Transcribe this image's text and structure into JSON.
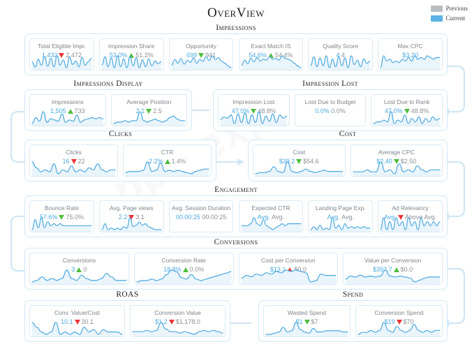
{
  "header": {
    "title": "OverView",
    "legend": [
      {
        "label": "Previous",
        "color": "#b9bdc1",
        "name": "previous"
      },
      {
        "label": "Current",
        "color": "#5cb3e4",
        "name": "current"
      }
    ]
  },
  "colors": {
    "current": "#4aa9e0",
    "previous": "#8a9097",
    "up_good": "#4fbe3f",
    "down_good": "#4fbe3f",
    "bad": "#ed3437",
    "card_border": "#d9eaf6",
    "group_border": "#cfe7f7",
    "spark_line": "#4aa9e0",
    "spark_fill": "#eaf4fb"
  },
  "watermark": "ppc expo",
  "groups": [
    {
      "id": "impressions",
      "title": "Impressions",
      "cards": [
        {
          "name": "total-eligible-impr",
          "label": "Total Eligible Impr.",
          "current": "1,432",
          "previous": "2,472",
          "trend": "down",
          "trend_tone": "bad",
          "spark": [
            10,
            4,
            13,
            6,
            16,
            5,
            14,
            4,
            17,
            6,
            12,
            3,
            16,
            7,
            11,
            4,
            15,
            6,
            10,
            14
          ]
        },
        {
          "name": "impression-share",
          "label": "Impression Share",
          "current": "53.0%",
          "previous": "51.2%",
          "trend": "up",
          "trend_tone": "good",
          "spark": [
            8,
            16,
            6,
            15,
            5,
            17,
            6,
            14,
            5,
            16,
            7,
            15,
            5,
            13,
            6,
            14,
            7,
            12,
            9,
            11
          ]
        },
        {
          "name": "opportunity",
          "label": "Opportunity",
          "current": "699",
          "previous": "941",
          "trend": "down",
          "trend_tone": "good",
          "spark": [
            6,
            12,
            8,
            13,
            7,
            11,
            9,
            14,
            8,
            12,
            10,
            15,
            11,
            16,
            12,
            14,
            10,
            8,
            5,
            3
          ]
        },
        {
          "name": "exact-match-is",
          "label": "Exact Match IS",
          "current": "54.6%",
          "previous": "54.4%",
          "trend": "up",
          "trend_tone": "good",
          "spark": [
            5,
            11,
            7,
            13,
            9,
            14,
            10,
            12,
            11,
            15,
            12,
            13,
            11,
            16,
            13,
            12,
            10,
            7,
            4,
            2
          ]
        },
        {
          "name": "quality-score",
          "label": "Quality Score",
          "current": "4",
          "previous": "4",
          "trend": "none",
          "trend_tone": "none",
          "spark": [
            7,
            15,
            6,
            14,
            7,
            16,
            5,
            13,
            6,
            15,
            7,
            14,
            5,
            16,
            8,
            12,
            6,
            13,
            9,
            11
          ]
        },
        {
          "name": "max-cpc",
          "label": "Max CPC",
          "current": "$3.20",
          "previous": "",
          "trend": "none",
          "trend_tone": "none",
          "spark": [
            6,
            13,
            10,
            11,
            9,
            10,
            9,
            11,
            10,
            12,
            10,
            13,
            11,
            12,
            11,
            13,
            12,
            11,
            12,
            12
          ]
        }
      ]
    },
    {
      "id": "impressions-display",
      "title": "Impressions Display",
      "cards": [
        {
          "name": "impressions",
          "label": "Impressions",
          "current": "1,505",
          "previous": "733",
          "trend": "up",
          "trend_tone": "good",
          "spark": [
            6,
            11,
            8,
            16,
            7,
            10,
            9,
            8,
            14,
            7,
            9,
            8,
            13,
            7,
            9,
            10,
            11,
            10,
            11,
            10
          ]
        },
        {
          "name": "average-position",
          "label": "Average Position",
          "current": "2.1",
          "previous": "2.5",
          "trend": "down",
          "trend_tone": "good",
          "spark": [
            7,
            8,
            8,
            9,
            8,
            9,
            9,
            15,
            9,
            8,
            9,
            10,
            9,
            8,
            9,
            11,
            12,
            10,
            9,
            9
          ]
        }
      ]
    },
    {
      "id": "impression-lost",
      "title": "Impression Lost",
      "cards": [
        {
          "name": "impression-lost",
          "label": "Impression Lost",
          "current": "47.0%",
          "previous": "48.8%",
          "trend": "down",
          "trend_tone": "good",
          "spark": [
            9,
            11,
            10,
            13,
            5,
            14,
            6,
            15,
            5,
            13,
            6,
            16,
            5,
            12,
            7,
            14,
            6,
            13,
            10,
            12
          ]
        },
        {
          "name": "lost-due-to-budget",
          "label": "Lost Due to Budget",
          "current": "0.0%",
          "previous": "0.0%",
          "trend": "none",
          "trend_tone": "none",
          "spark": []
        },
        {
          "name": "lost-due-to-rank",
          "label": "Lost Due to Rank",
          "current": "47.0%",
          "previous": "48.8%",
          "trend": "down",
          "trend_tone": "good",
          "spark": [
            8,
            9,
            9,
            10,
            9,
            15,
            8,
            10,
            9,
            13,
            8,
            11,
            9,
            12,
            8,
            11,
            9,
            12,
            10,
            11
          ]
        }
      ]
    },
    {
      "id": "clicks",
      "title": "Clicks",
      "cards": [
        {
          "name": "clicks",
          "label": "Clicks",
          "current": "16",
          "previous": "22",
          "trend": "down",
          "trend_tone": "bad",
          "spark": [
            13,
            10,
            8,
            9,
            8,
            12,
            7,
            9,
            8,
            11,
            8,
            9,
            8,
            10,
            9,
            12,
            9,
            8,
            9,
            9
          ]
        },
        {
          "name": "ctr",
          "label": "CTR",
          "current": "2.2%",
          "previous": "1.4%",
          "trend": "up",
          "trend_tone": "good",
          "spark": [
            7,
            8,
            8,
            8,
            9,
            16,
            8,
            9,
            15,
            8,
            9,
            8,
            9,
            8,
            7,
            6,
            8,
            9,
            10,
            10
          ]
        }
      ]
    },
    {
      "id": "cost",
      "title": "Cost",
      "cards": [
        {
          "name": "cost",
          "label": "Cost",
          "current": "$39.2",
          "previous": "$54.6",
          "trend": "down",
          "trend_tone": "good",
          "spark": [
            7,
            8,
            8,
            9,
            13,
            9,
            8,
            17,
            9,
            8,
            9,
            11,
            9,
            8,
            9,
            10,
            9,
            9,
            9,
            9
          ]
        },
        {
          "name": "average-cpc",
          "label": "Average CPC",
          "current": "$2.40",
          "previous": "$2.50",
          "trend": "down",
          "trend_tone": "good",
          "spark": [
            9,
            9,
            9,
            10,
            9,
            9,
            14,
            9,
            10,
            8,
            13,
            9,
            10,
            9,
            12,
            10,
            9,
            10,
            10,
            10
          ]
        }
      ]
    },
    {
      "id": "engagement",
      "title": "Engagement",
      "cards": [
        {
          "name": "bounce-rate",
          "label": "Bounce Rate",
          "current": "57.6%",
          "previous": "75.0%",
          "trend": "down",
          "trend_tone": "good",
          "spark": [
            8,
            13,
            9,
            14,
            9,
            12,
            10,
            11,
            10,
            11,
            10,
            10,
            10,
            10,
            10,
            10,
            10,
            10,
            10,
            10
          ]
        },
        {
          "name": "avg-page-views",
          "label": "Avg. Page views",
          "current": "2.2",
          "previous": "3.1",
          "trend": "down",
          "trend_tone": "bad",
          "spark": [
            9,
            13,
            9,
            10,
            9,
            10,
            9,
            11,
            10,
            17,
            11,
            12,
            14,
            12,
            13,
            11,
            10,
            9,
            9,
            9
          ]
        },
        {
          "name": "avg-session-duration",
          "label": "Avg. Session Duration",
          "current": "00:00:25",
          "previous": "00:00:25",
          "trend": "none",
          "trend_tone": "none",
          "spark": []
        },
        {
          "name": "expected-ctr",
          "label": "Expected CTR",
          "current": "Avg.",
          "previous": "Avg.",
          "trend": "none",
          "trend_tone": "none",
          "spark": [
            9,
            9,
            9,
            10,
            13,
            10,
            9,
            12,
            9,
            8,
            7,
            8,
            9,
            10,
            9,
            10,
            10,
            10,
            10,
            10
          ]
        },
        {
          "name": "landing-page-exp",
          "label": "Landing Page Exp.",
          "current": "Avg.",
          "previous": "Avg.",
          "trend": "none",
          "trend_tone": "none",
          "spark": [
            9,
            11,
            9,
            12,
            9,
            10,
            9,
            17,
            10,
            12,
            9,
            13,
            10,
            11,
            10,
            11,
            10,
            11,
            10,
            10
          ]
        },
        {
          "name": "ad-relevancy",
          "label": "Ad Relevancy",
          "current": "Avg.",
          "previous": "Above Avg.",
          "trend": "down",
          "trend_tone": "bad",
          "spark": [
            9,
            12,
            9,
            11,
            9,
            12,
            10,
            11,
            9,
            12,
            10,
            11,
            9,
            12,
            10,
            11,
            10,
            11,
            10,
            11
          ]
        }
      ]
    },
    {
      "id": "conversions",
      "title": "Conversions",
      "cards": [
        {
          "name": "conversions",
          "label": "Conversions",
          "current": "3",
          "previous": "0",
          "trend": "up",
          "trend_tone": "good",
          "spark": [
            8,
            9,
            11,
            9,
            10,
            9,
            10,
            15,
            10,
            9,
            12,
            10,
            9,
            9,
            10,
            13,
            11,
            9,
            9,
            9
          ]
        },
        {
          "name": "conversion-rate",
          "label": "Conversion Rate",
          "current": "18.8%",
          "previous": "0.0%",
          "trend": "up",
          "trend_tone": "good",
          "spark": [
            8,
            9,
            9,
            10,
            9,
            10,
            13,
            16,
            15,
            11,
            10,
            13,
            10,
            9,
            10,
            11,
            12,
            13,
            14,
            15
          ]
        },
        {
          "name": "cost-per-conversion",
          "label": "Cost per Conversion",
          "current": "$13.1",
          "previous": "$0.0",
          "trend": "up",
          "trend_tone": "bad",
          "spark": [
            8,
            10,
            9,
            11,
            10,
            12,
            11,
            13,
            12,
            14,
            13,
            14,
            13,
            12,
            5,
            6,
            11,
            10,
            10,
            10
          ]
        },
        {
          "name": "value-per-conversion",
          "label": "Value per Conversion",
          "current": "$392.7",
          "previous": "$0.0",
          "trend": "up",
          "trend_tone": "good",
          "spark": [
            8,
            11,
            10,
            12,
            10,
            11,
            10,
            11,
            17,
            11,
            10,
            11,
            10,
            9,
            5,
            7,
            9,
            10,
            10,
            10
          ]
        }
      ]
    },
    {
      "id": "roas",
      "title": "ROAS",
      "cards": [
        {
          "name": "conv-value-cost",
          "label": "Conv. Value/Cost",
          "current": "10.1",
          "previous": "30.1",
          "trend": "down",
          "trend_tone": "bad",
          "spark": [
            13,
            11,
            9,
            8,
            9,
            13,
            8,
            9,
            8,
            9,
            8,
            11,
            9,
            10,
            8,
            10,
            9,
            9,
            9,
            8
          ]
        },
        {
          "name": "conversion-value",
          "label": "Conversion Value",
          "current": "$1.2",
          "previous": "$1,178.0",
          "trend": "down",
          "trend_tone": "bad",
          "spark": [
            9,
            9,
            9,
            10,
            9,
            10,
            16,
            11,
            9,
            9,
            8,
            9,
            8,
            7,
            9,
            10,
            9,
            10,
            9,
            8
          ]
        }
      ]
    },
    {
      "id": "spend",
      "title": "Spend",
      "cards": [
        {
          "name": "wasted-spend",
          "label": "Wasted Spend",
          "current": "$1",
          "previous": "$7",
          "trend": "down",
          "trend_tone": "good",
          "spark": [
            8,
            8,
            9,
            10,
            14,
            10,
            11,
            18,
            12,
            10,
            9,
            13,
            10,
            10,
            11,
            11,
            11,
            11,
            10,
            10
          ]
        },
        {
          "name": "conversion-spend",
          "label": "Conversion Spend",
          "current": "$19",
          "previous": "$70",
          "trend": "down",
          "trend_tone": "bad",
          "spark": [
            9,
            10,
            10,
            11,
            10,
            11,
            15,
            11,
            10,
            13,
            11,
            10,
            11,
            14,
            11,
            10,
            11,
            10,
            11,
            11
          ]
        }
      ]
    }
  ]
}
